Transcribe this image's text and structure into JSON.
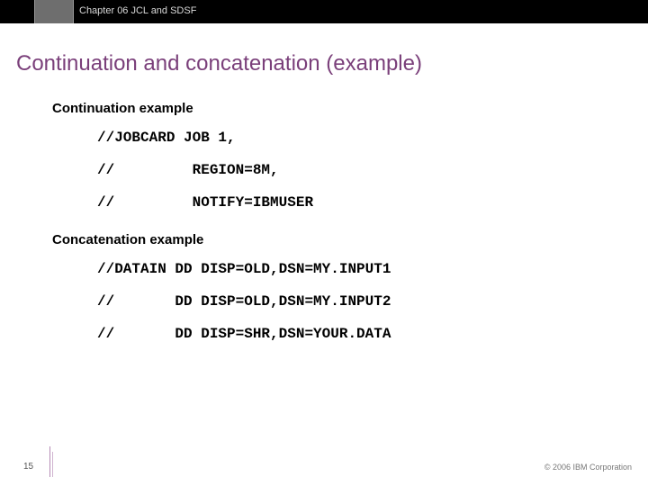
{
  "header": {
    "chapter": "Chapter 06 JCL and SDSF"
  },
  "title": "Continuation and concatenation (example)",
  "section1": {
    "label": "Continuation example",
    "lines": [
      "//JOBCARD JOB 1,",
      "//         REGION=8M,",
      "//         NOTIFY=IBMUSER"
    ]
  },
  "section2": {
    "label": "Concatenation example",
    "lines": [
      "//DATAIN DD DISP=OLD,DSN=MY.INPUT1",
      "//       DD DISP=OLD,DSN=MY.INPUT2",
      "//       DD DISP=SHR,DSN=YOUR.DATA"
    ]
  },
  "footer": {
    "page": "15",
    "copyright": "© 2006 IBM Corporation"
  }
}
